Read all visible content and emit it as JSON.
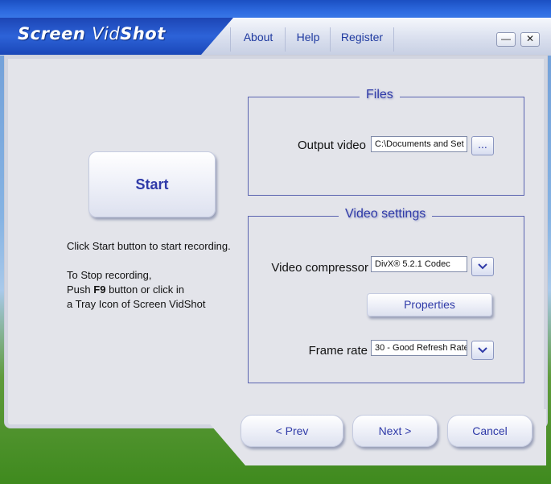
{
  "app": {
    "title_part1": "Screen",
    "title_part2": "Vid",
    "title_part3": "Shot"
  },
  "menu": {
    "about": "About",
    "help": "Help",
    "register": "Register"
  },
  "window_controls": {
    "minimize": "—",
    "close": "✕"
  },
  "start_button": "Start",
  "instructions": {
    "line1": "Click Start button to start recording.",
    "line2_prefix": "To Stop recording,",
    "line3_prefix": "Push",
    "hotkey": "F9",
    "line3_suffix": "button or click in",
    "line4": "a Tray Icon of Screen VidShot"
  },
  "files": {
    "title": "Files",
    "output_label": "Output video",
    "output_value": "C:\\Documents and Set",
    "browse_label": "..."
  },
  "video_settings": {
    "title": "Video settings",
    "compressor_label": "Video compressor",
    "compressor_value": "DivX® 5.2.1 Codec",
    "properties_label": "Properties",
    "frame_rate_label": "Frame rate",
    "frame_rate_value": "30 - Good Refresh Rate"
  },
  "nav": {
    "prev": "< Prev",
    "next": "Next >",
    "cancel": "Cancel"
  }
}
